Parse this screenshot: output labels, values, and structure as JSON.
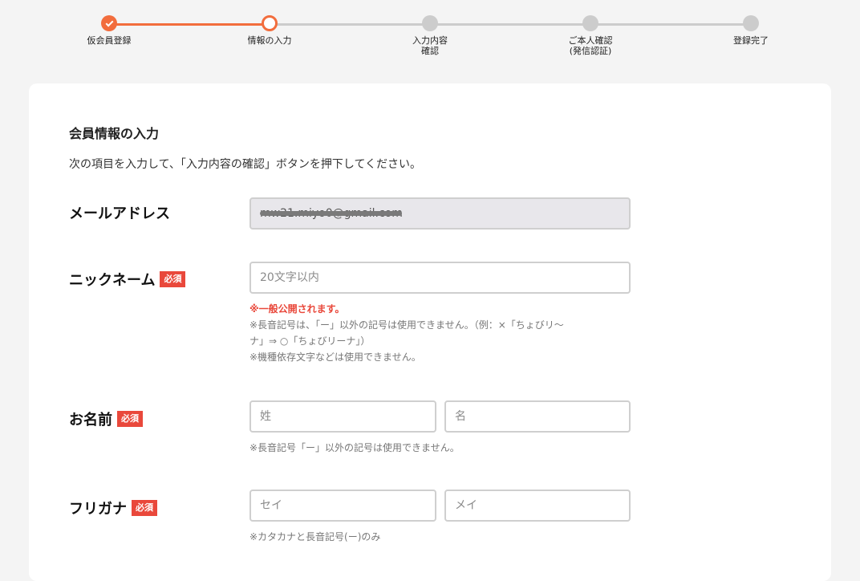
{
  "stepper": {
    "steps": [
      {
        "label": "仮会員登録",
        "state": "done"
      },
      {
        "label": "情報の入力",
        "state": "current"
      },
      {
        "label": "入力内容\n確認",
        "state": "todo"
      },
      {
        "label": "ご本人確認\n(発信認証)",
        "state": "todo"
      },
      {
        "label": "登録完了",
        "state": "todo"
      }
    ],
    "accent_color": "#f26d3d"
  },
  "form": {
    "title": "会員情報の入力",
    "description": "次の項目を入力して、「入力内容の確認」ボタンを押下してください。",
    "required_label": "必須",
    "email": {
      "label": "メールアドレス",
      "value": "mw21.miyo0@gmail.com"
    },
    "nickname": {
      "label": "ニックネーム",
      "placeholder": "20文字以内",
      "note_public": "※一般公開されます。",
      "note_rules": "※長音記号は、「ー」以外の記号は使用できません。（例：×「ちょびリ〜\nナ」⇒ ○「ちょびリーナ」）\n※機種依存文字などは使用できません。"
    },
    "name": {
      "label": "お名前",
      "last_placeholder": "姓",
      "first_placeholder": "名",
      "note": "※長音記号「ー」以外の記号は使用できません。"
    },
    "furigana": {
      "label": "フリガナ",
      "last_placeholder": "セイ",
      "first_placeholder": "メイ",
      "note": "※カタカナと長音記号(ー)のみ"
    }
  }
}
